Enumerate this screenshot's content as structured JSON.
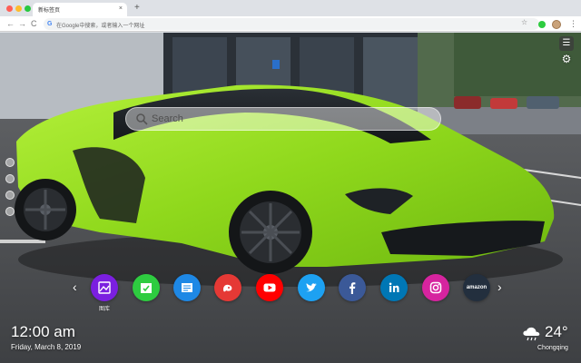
{
  "browser": {
    "tab_title": "新标签页",
    "tab_close": "×",
    "new_tab": "+",
    "back": "←",
    "forward": "→",
    "reload": "C",
    "omnibox_icon": "G",
    "omnibox_placeholder": "在Google中搜索，或者输入一个网址",
    "bookmark_icon": "☆",
    "menu_icon": "⋮"
  },
  "page": {
    "menu_icon": "hamburger-icon",
    "settings_icon": "gear-icon",
    "search_placeholder": "Search",
    "shortcut_prev": "‹",
    "shortcut_next": "›",
    "shortcuts": [
      {
        "name": "gallery",
        "label": "图库",
        "color": "#7b1fe0",
        "icon": "image-icon"
      },
      {
        "name": "tasks",
        "label": "",
        "color": "#2ecc40",
        "icon": "checklist-icon"
      },
      {
        "name": "notes",
        "label": "",
        "color": "#1e88e5",
        "icon": "notes-icon"
      },
      {
        "name": "games",
        "label": "",
        "color": "#e53935",
        "icon": "gamepad-icon"
      },
      {
        "name": "youtube",
        "label": "",
        "color": "#ff0000",
        "icon": "play-icon"
      },
      {
        "name": "twitter",
        "label": "",
        "color": "#1da1f2",
        "icon": "twitter-icon"
      },
      {
        "name": "facebook",
        "label": "",
        "color": "#3b5998",
        "icon": "facebook-icon"
      },
      {
        "name": "linkedin",
        "label": "",
        "color": "#0077b5",
        "icon": "linkedin-icon"
      },
      {
        "name": "instagram",
        "label": "",
        "color": "#d6249f",
        "icon": "instagram-icon"
      },
      {
        "name": "amazon",
        "label": "amazon",
        "color": "#232f3e",
        "icon": "amazon-icon"
      }
    ],
    "time": "12:00 am",
    "date": "Friday, March 8, 2019",
    "weather": {
      "icon": "cloud-rain-icon",
      "temperature": "24°",
      "city": "Chongqing"
    }
  }
}
